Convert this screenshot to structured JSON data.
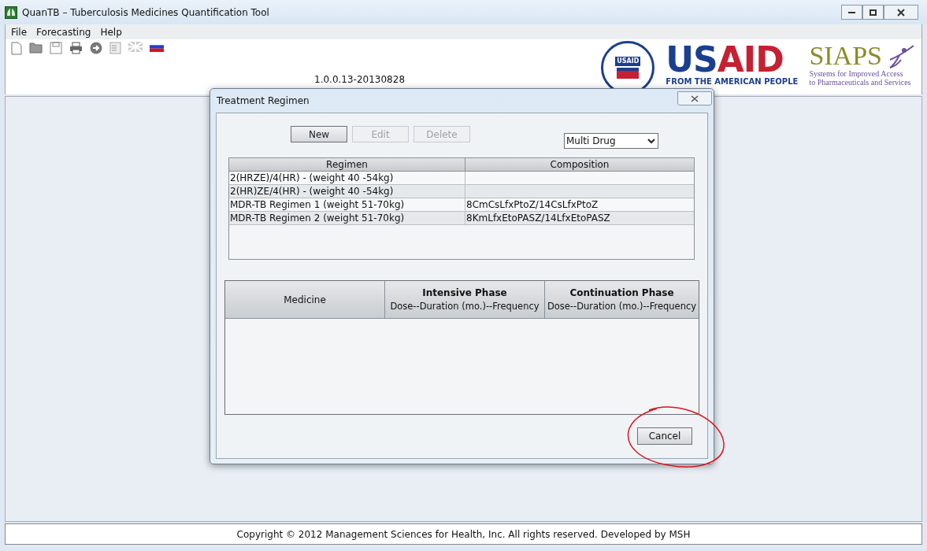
{
  "window": {
    "title": "QuanTB – Tuberculosis Medicines Quantification Tool"
  },
  "menu": [
    "File",
    "Forecasting",
    "Help"
  ],
  "logos": {
    "seal_label": "USAID",
    "usaid_blue": "US",
    "usaid_red": "AID",
    "usaid_tagline": "FROM THE AMERICAN PEOPLE",
    "siaps_name": "SIAPS",
    "siaps_line_1": "Systems for Improved Access",
    "siaps_line_2": "to Pharmaceuticals and Services"
  },
  "version": "1.0.0.13-20130828",
  "dialog": {
    "title": "Treatment Regimen",
    "buttons": [
      {
        "label": "New",
        "disabled": false
      },
      {
        "label": "Edit",
        "disabled": true
      },
      {
        "label": "Delete",
        "disabled": true
      }
    ],
    "filter": {
      "value": "Multi Drug"
    },
    "regimens": {
      "columns": [
        "Regimen",
        "Composition"
      ],
      "rows": [
        {
          "cells": [
            "2(HRZE)/4(HR) - (weight 40 -54kg)",
            ""
          ]
        },
        {
          "cells": [
            "2(HR)ZE/4(HR) - (weight 40 -54kg)",
            ""
          ]
        },
        {
          "cells": [
            "MDR-TB Regimen 1 (weight 51-70kg)",
            "8CmCsLfxPtoZ/14CsLfxPtoZ"
          ]
        },
        {
          "cells": [
            "MDR-TB Regimen 2 (weight 51-70kg)",
            "8KmLfxEtoPASZ/14LfxEtoPASZ"
          ]
        }
      ]
    },
    "medicines": {
      "columns": [
        {
          "title": "Medicine"
        },
        {
          "title": "Intensive Phase",
          "subtitle": "Dose--Duration (mo.)--Frequency"
        },
        {
          "title": "Continuation Phase",
          "subtitle": "Dose--Duration (mo.)--Frequency"
        }
      ]
    },
    "cancel": "Cancel"
  },
  "status_bar": "Copyright © 2012 Management Sciences for Health, Inc. All rights reserved. Developed by MSH"
}
